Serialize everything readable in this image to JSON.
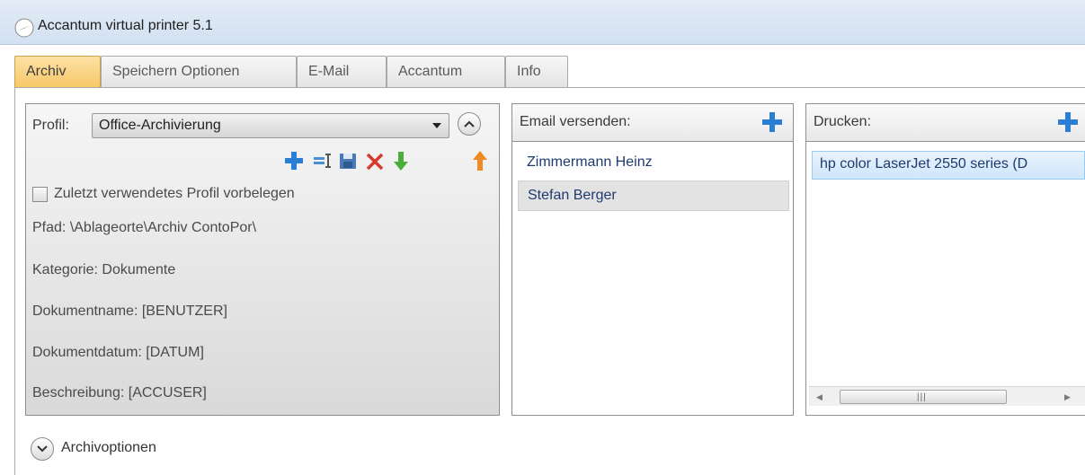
{
  "window": {
    "title": "Accantum virtual printer 5.1",
    "icon": "app-icon"
  },
  "tabs": [
    {
      "label": "Archiv",
      "active": true
    },
    {
      "label": "Speichern Optionen",
      "active": false
    },
    {
      "label": "E-Mail",
      "active": false
    },
    {
      "label": "Accantum",
      "active": false
    },
    {
      "label": "Info",
      "active": false
    }
  ],
  "archiv": {
    "profil_label": "Profil:",
    "profil_value": "Office-Archivierung",
    "toolbar_icons": [
      "plus-icon",
      "rename-icon",
      "save-icon",
      "delete-icon",
      "move-down-icon",
      "move-up-icon"
    ],
    "checkbox_label": "Zuletzt verwendetes Profil vorbelegen",
    "checkbox_checked": false,
    "fields": [
      {
        "label": "Pfad:",
        "value": "\\Ablageorte\\Archiv ContoPor\\"
      },
      {
        "label": "Kategorie:",
        "value": "Dokumente"
      },
      {
        "label": "Dokumentname:",
        "value": "[BENUTZER]"
      },
      {
        "label": "Dokumentdatum:",
        "value": "[DATUM]"
      },
      {
        "label": "Beschreibung:",
        "value": "[ACCUSER]"
      }
    ]
  },
  "email": {
    "header": "Email versenden:",
    "items": [
      "Zimmermann Heinz",
      "Stefan Berger"
    ],
    "selected_index": 1
  },
  "print": {
    "header": "Drucken:",
    "items": [
      "hp color LaserJet 2550 series (D"
    ],
    "selected_index": 0
  },
  "archivoptionen": {
    "label": "Archivoptionen"
  },
  "colors": {
    "accent_blue": "#2a7fd4",
    "active_tab": "#f6c766",
    "delete_red": "#d9392b",
    "arrow_green": "#4cae3a",
    "arrow_orange": "#f08a24"
  }
}
